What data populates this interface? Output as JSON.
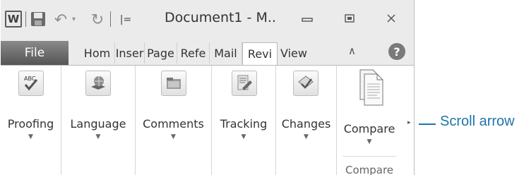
{
  "title_bar": {
    "app_icon_letter": "W",
    "undo_dropdown": "▾",
    "qat_customize": "|=",
    "document_title": "Document1  -  M..",
    "minimize": "▭",
    "restore": "▣",
    "close": "✕"
  },
  "tabs": [
    {
      "label": "File",
      "active": false
    },
    {
      "label": "Hom",
      "active": false
    },
    {
      "label": "Inser",
      "active": false
    },
    {
      "label": "Page",
      "active": false
    },
    {
      "label": "Refe",
      "active": false
    },
    {
      "label": "Mail",
      "active": false
    },
    {
      "label": "Revi",
      "active": true
    },
    {
      "label": "View",
      "active": false
    }
  ],
  "ribbon_controls": {
    "minimize_ribbon": "∧",
    "help": "?"
  },
  "groups": [
    {
      "label": "Proofing",
      "icon": "spelling-abc-check-icon",
      "abc": "ABC"
    },
    {
      "label": "Language",
      "icon": "language-globe-icon"
    },
    {
      "label": "Comments",
      "icon": "comment-icon"
    },
    {
      "label": "Tracking",
      "icon": "track-changes-icon"
    },
    {
      "label": "Changes",
      "icon": "accept-changes-icon"
    },
    {
      "label": "Compare",
      "icon": "compare-documents-icon",
      "group_label": "Compare"
    }
  ],
  "dropdown_glyph": "▼",
  "scroll_arrow_glyph": "▸",
  "callout": {
    "label": "Scroll arrow",
    "color": "#1f74a8"
  }
}
